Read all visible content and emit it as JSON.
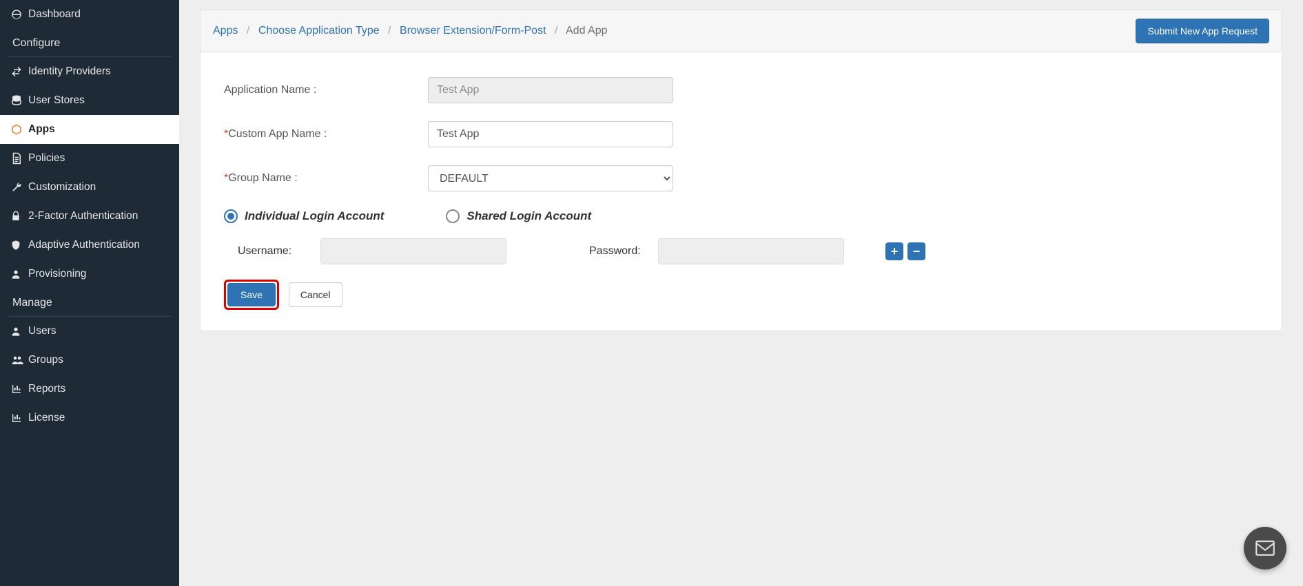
{
  "sidebar": {
    "dashboard": "Dashboard",
    "configure": "Configure",
    "manage": "Manage",
    "items": {
      "idp": "Identity Providers",
      "userstores": "User Stores",
      "apps": "Apps",
      "policies": "Policies",
      "customization": "Customization",
      "twofactor": "2-Factor Authentication",
      "adaptive": "Adaptive Authentication",
      "provisioning": "Provisioning",
      "users": "Users",
      "groups": "Groups",
      "reports": "Reports",
      "license": "License"
    }
  },
  "breadcrumb": {
    "apps": "Apps",
    "choose": "Choose Application Type",
    "browser": "Browser Extension/Form-Post",
    "addapp": "Add App"
  },
  "header": {
    "submit": "Submit New App Request"
  },
  "form": {
    "app_name_label": "Application Name :",
    "app_name_value": "Test App",
    "custom_name_label": "Custom App Name :",
    "custom_name_value": "Test App",
    "group_label": "Group Name :",
    "group_value": "DEFAULT",
    "individual": "Individual Login Account",
    "shared": "Shared Login Account",
    "username_label": "Username:",
    "username_value": "",
    "password_label": "Password:",
    "password_value": "",
    "plus": "+",
    "minus": "−",
    "save": "Save",
    "cancel": "Cancel"
  }
}
